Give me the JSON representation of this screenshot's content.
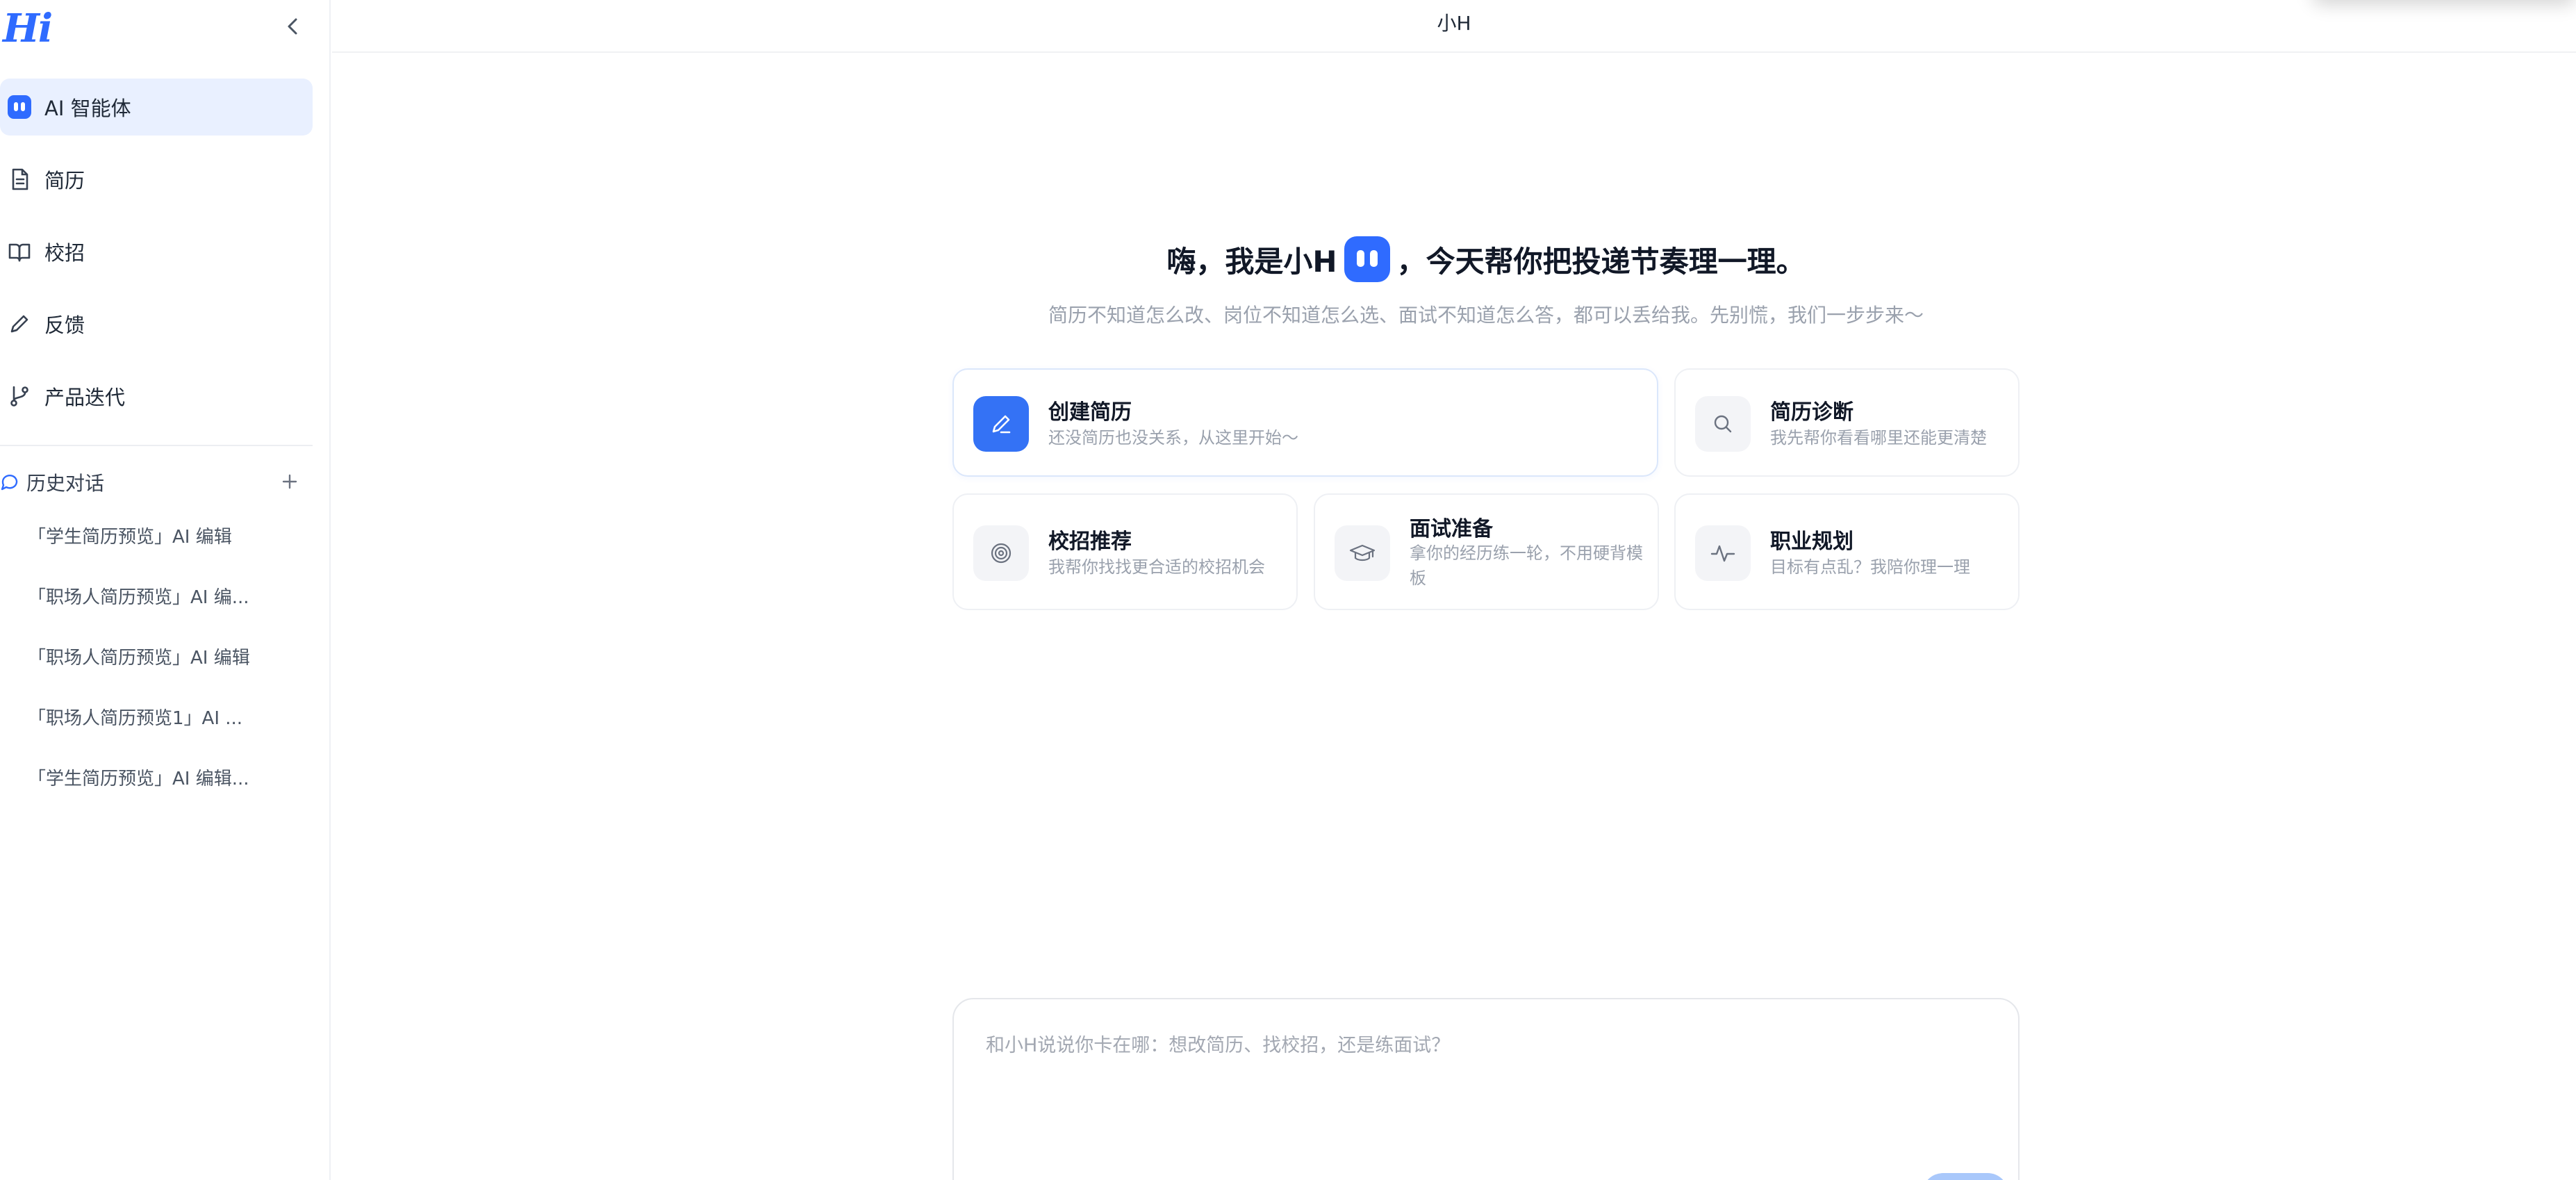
{
  "app": {
    "logo": "Hi",
    "header_title": "小H"
  },
  "sidebar": {
    "nav": [
      {
        "label": "AI 智能体",
        "icon": "bot-icon",
        "active": true
      },
      {
        "label": "简历",
        "icon": "document-icon"
      },
      {
        "label": "校招",
        "icon": "book-icon"
      },
      {
        "label": "反馈",
        "icon": "pen-icon"
      },
      {
        "label": "产品迭代",
        "icon": "git-branch-icon"
      }
    ],
    "history": {
      "title": "历史对话",
      "items": [
        "「学生简历预览」AI 编辑",
        "「职场人简历预览」AI 编...",
        "「职场人简历预览」AI 编辑",
        "「职场人简历预览1」AI ...",
        "「学生简历预览」AI 编辑..."
      ]
    }
  },
  "hero": {
    "title_before": "嗨，我是小H",
    "title_after": "，今天帮你把投递节奏理一理。",
    "subtitle": "简历不知道怎么改、岗位不知道怎么选、面试不知道怎么答，都可以丢给我。先别慌，我们一步步来～"
  },
  "cards": {
    "create": {
      "title": "创建简历",
      "desc": "还没简历也没关系，从这里开始～",
      "icon": "pencil-icon"
    },
    "diagnose": {
      "title": "简历诊断",
      "desc": "我先帮你看看哪里还能更清楚",
      "icon": "search-icon"
    },
    "campus": {
      "title": "校招推荐",
      "desc": "我帮你找找更合适的校招机会",
      "icon": "target-icon"
    },
    "interview": {
      "title": "面试准备",
      "desc": "拿你的经历练一轮，不用硬背模板",
      "icon": "graduation-cap-icon"
    },
    "career": {
      "title": "职业规划",
      "desc": "目标有点乱？我陪你理一理",
      "icon": "pulse-icon"
    }
  },
  "composer": {
    "placeholder": "和小H说说你卡在哪：想改简历、找校招，还是练面试？"
  },
  "colors": {
    "accent": "#2f6bff",
    "active_bg": "#e9f0ff"
  }
}
